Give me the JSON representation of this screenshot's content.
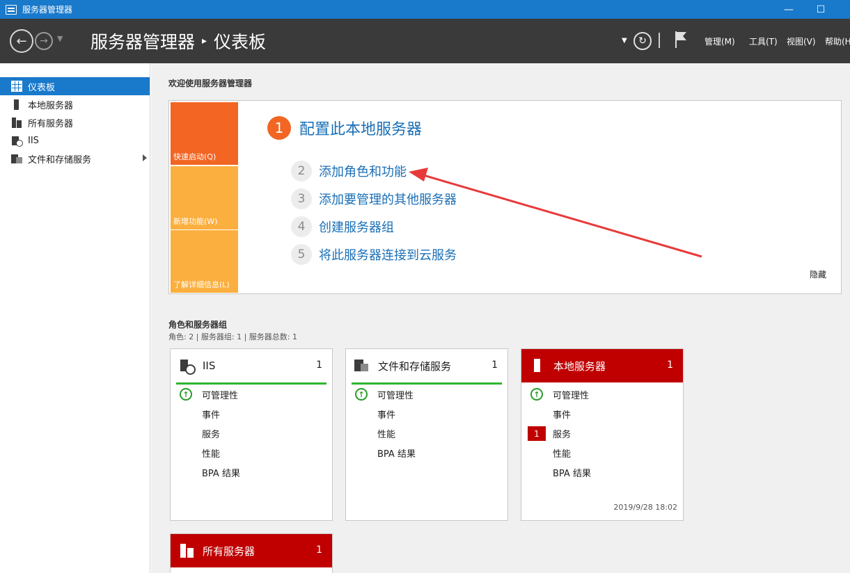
{
  "window": {
    "title": "服务器管理器",
    "minimize": "—",
    "maximize": "☐"
  },
  "header": {
    "breadcrumb_root": "服务器管理器",
    "breadcrumb_sep": "▸",
    "breadcrumb_current": "仪表板",
    "menus": [
      "管理(M)",
      "工具(T)",
      "视图(V)",
      "帮助(H)"
    ]
  },
  "sidebar": {
    "items": [
      {
        "label": "仪表板",
        "active": true
      },
      {
        "label": "本地服务器"
      },
      {
        "label": "所有服务器"
      },
      {
        "label": "IIS"
      },
      {
        "label": "文件和存储服务"
      }
    ]
  },
  "welcome": {
    "title": "欢迎使用服务器管理器",
    "tiles": [
      "快速启动(Q)",
      "新增功能(W)",
      "了解详细信息(L)"
    ],
    "main_step": {
      "num": "1",
      "label": "配置此本地服务器"
    },
    "steps": [
      {
        "num": "2",
        "label": "添加角色和功能"
      },
      {
        "num": "3",
        "label": "添加要管理的其他服务器"
      },
      {
        "num": "4",
        "label": "创建服务器组"
      },
      {
        "num": "5",
        "label": "将此服务器连接到云服务"
      }
    ],
    "hide": "隐藏"
  },
  "roles": {
    "title": "角色和服务器组",
    "subtitle": "角色: 2 | 服务器组: 1 | 服务器总数: 1",
    "rows": [
      "可管理性",
      "事件",
      "服务",
      "性能",
      "BPA 结果"
    ],
    "cards": [
      {
        "name": "IIS",
        "count": "1"
      },
      {
        "name": "文件和存储服务",
        "count": "1"
      },
      {
        "name": "本地服务器",
        "count": "1",
        "badge": "1",
        "timestamp": "2019/9/28 18:02"
      },
      {
        "name": "所有服务器",
        "count": "1"
      }
    ]
  },
  "colors": {
    "accent": "#1979ca",
    "orange": "#f26522",
    "amber": "#fbaf3f",
    "alert": "#c00000",
    "ok": "#2fb52f"
  }
}
